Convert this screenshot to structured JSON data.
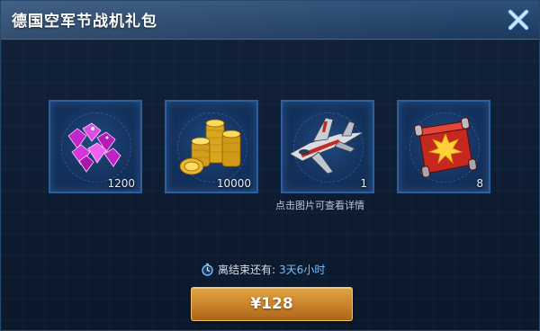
{
  "dialog": {
    "title": "德国空军节战机礼包",
    "close_icon": "close-icon"
  },
  "items": [
    {
      "name": "gems",
      "icon": "purple-gems-icon",
      "count": "1200"
    },
    {
      "name": "coins",
      "icon": "gold-coins-icon",
      "count": "10000"
    },
    {
      "name": "fighter-jet",
      "icon": "fighter-jet-icon",
      "count": "1"
    },
    {
      "name": "scroll",
      "icon": "red-scroll-icon",
      "count": "8"
    }
  ],
  "hint": "点击图片可查看详情",
  "timer": {
    "icon": "stopwatch-icon",
    "label": "离结束还有:",
    "value": "3天6小时"
  },
  "buy_button": {
    "label": "¥128"
  },
  "colors": {
    "accent": "#6ec0ff",
    "button": "#c9822a",
    "title_bar": "#2d4f78"
  }
}
